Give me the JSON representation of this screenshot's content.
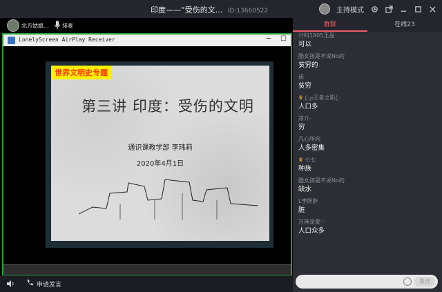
{
  "window": {
    "title": "印度——“受伤的文...",
    "room_id": "ID:13660522",
    "mode_label": "主持模式"
  },
  "host": {
    "name": "北方姑娘...",
    "mic_label": "排麦"
  },
  "app": {
    "title": "LonelyScreen AirPlay Receiver"
  },
  "slide": {
    "badge": "世界文明史专题",
    "title": "第三讲  印度：受伤的文明",
    "dept": "通识课教学部  李玮莉",
    "date": "2020年4月1日"
  },
  "footer": {
    "apply_label": "申请发言"
  },
  "chat": {
    "tabs": [
      {
        "label": "群聊",
        "active": true
      },
      {
        "label": "在线23",
        "active": false
      }
    ],
    "messages": [
      {
        "name": "计科1905王品",
        "text": "可以",
        "crown": false
      },
      {
        "name": "酷女孩是不说No的",
        "text": "贫穷的",
        "crown": false
      },
      {
        "name": "诺",
        "text": "贫穷",
        "crown": false
      },
      {
        "name": "ꦿ℘王者之影ꦿ",
        "text": "人口多",
        "crown": true
      },
      {
        "name": "凉介-",
        "text": "穷",
        "crown": false
      },
      {
        "name": "凡心所向",
        "text": "人多密集",
        "crown": false
      },
      {
        "name": "七七",
        "text": "种族",
        "crown": true
      },
      {
        "name": "酷女孩是不说No的",
        "text": "缺水",
        "crown": false
      },
      {
        "name": "L李胖胖",
        "text": "脏",
        "crown": false
      },
      {
        "name": "万神宠爱♡",
        "text": "人口众多",
        "crown": false
      }
    ],
    "send_label": "发送"
  }
}
